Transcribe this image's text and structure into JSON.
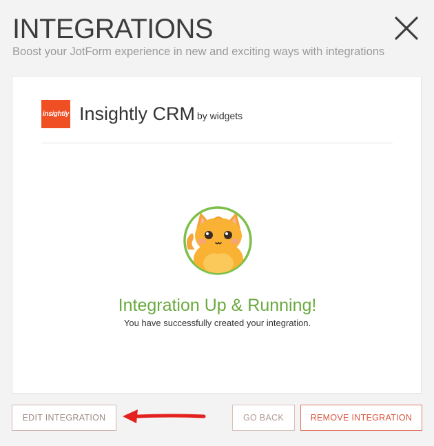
{
  "header": {
    "title": "INTEGRATIONS",
    "subtitle": "Boost your JotForm experience in new and exciting ways with integrations",
    "close_icon": "close-icon"
  },
  "integration": {
    "logo_text": "insightly",
    "name": "Insightly CRM",
    "by": "by widgets",
    "brand_color": "#f04e23"
  },
  "status": {
    "title": "Integration Up & Running!",
    "message": "You have successfully created your integration.",
    "color": "#6aaa3f"
  },
  "footer": {
    "edit_label": "EDIT INTEGRATION",
    "back_label": "GO BACK",
    "remove_label": "REMOVE INTEGRATION"
  },
  "colors": {
    "background": "#f3f3f3",
    "title": "#3d3d3d",
    "remove_accent": "#d9553c",
    "annotation_arrow": "#e3211e"
  }
}
